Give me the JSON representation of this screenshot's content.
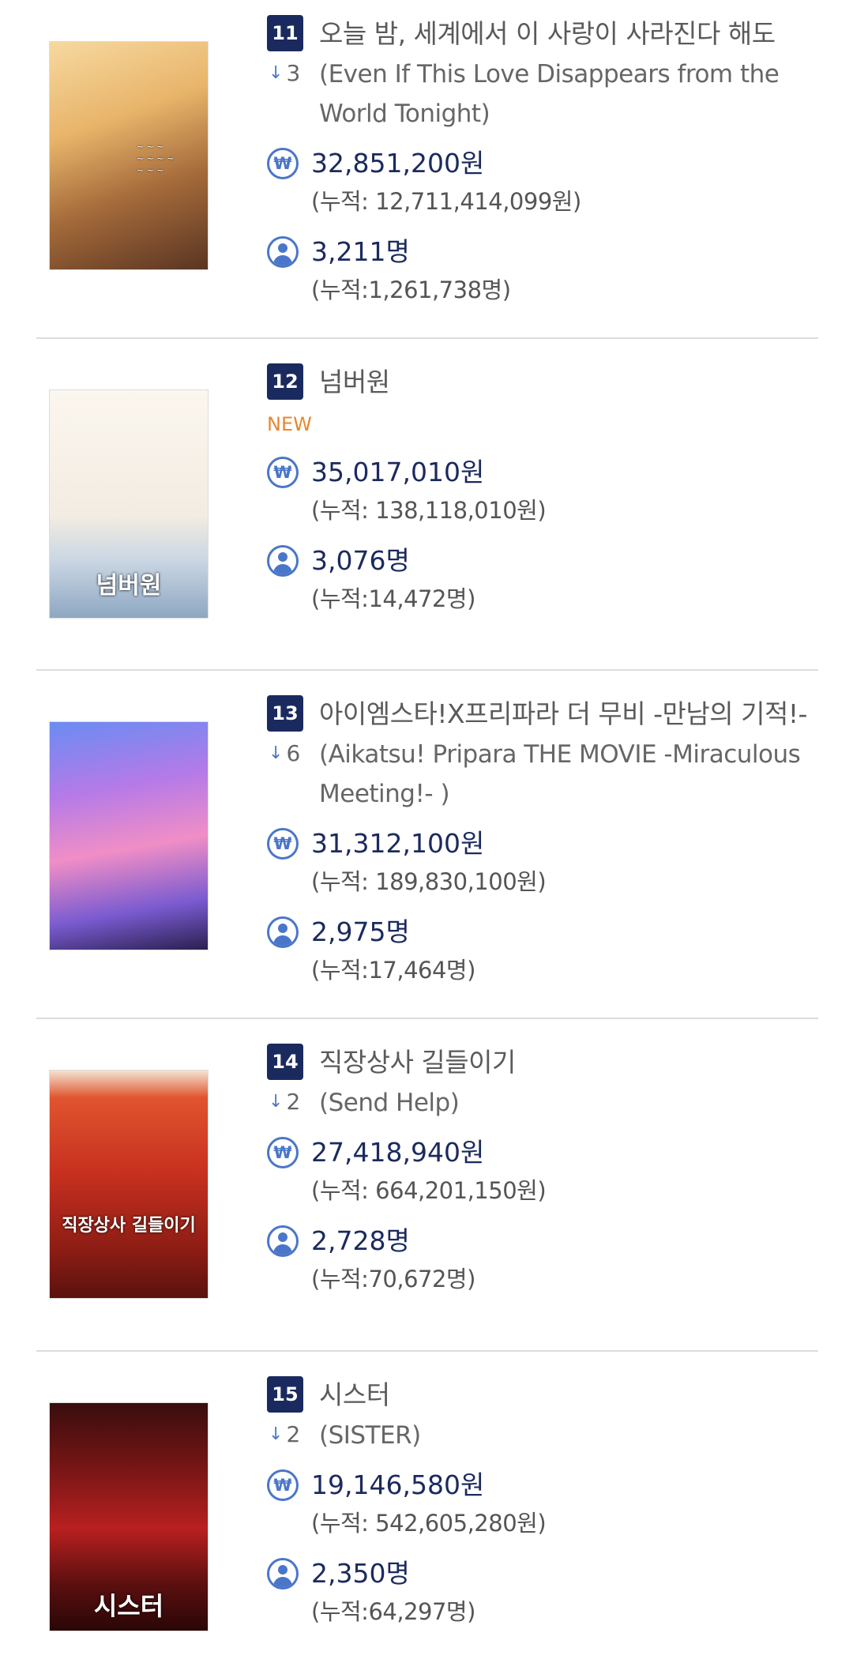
{
  "movies": [
    {
      "rank": "11",
      "title": "오늘 밤, 세계에서 이 사랑이 사라진다 해도",
      "change": "3",
      "subtitle": "(Even If This Love Disappears from the World Tonight)",
      "revenue": "32,851,200원",
      "revenue_total": "(누적: 12,711,414,099원)",
      "audience": "3,211명",
      "audience_total": "(누적:1,261,738명)"
    },
    {
      "rank": "12",
      "title": "넘버원",
      "new_label": "NEW",
      "poster_title": "넘버원",
      "revenue": "35,017,010원",
      "revenue_total": "(누적: 138,118,010원)",
      "audience": "3,076명",
      "audience_total": "(누적:14,472명)"
    },
    {
      "rank": "13",
      "title": "아이엠스타!X프리파라 더 무비 -만남의 기적!-",
      "change": "6",
      "subtitle": "(Aikatsu! Pripara THE MOVIE -Miraculous Meeting!- )",
      "revenue": "31,312,100원",
      "revenue_total": "(누적: 189,830,100원)",
      "audience": "2,975명",
      "audience_total": "(누적:17,464명)"
    },
    {
      "rank": "14",
      "title": "직장상사 길들이기",
      "change": "2",
      "subtitle": "(Send Help)",
      "poster_title": "직장상사 길들이기",
      "revenue": "27,418,940원",
      "revenue_total": "(누적: 664,201,150원)",
      "audience": "2,728명",
      "audience_total": "(누적:70,672명)"
    },
    {
      "rank": "15",
      "title": "시스터",
      "change": "2",
      "subtitle": "(SISTER)",
      "poster_title": "시스터",
      "revenue": "19,146,580원",
      "revenue_total": "(누적: 542,605,280원)",
      "audience": "2,350명",
      "audience_total": "(누적:64,297명)"
    }
  ],
  "icons": {
    "won": "won-icon",
    "person": "person-icon",
    "down_arrow": "down-arrow-icon"
  },
  "colors": {
    "rank_badge": "#1b2a5e",
    "icon_blue": "#4a76c9",
    "new_orange": "#e8872f"
  }
}
